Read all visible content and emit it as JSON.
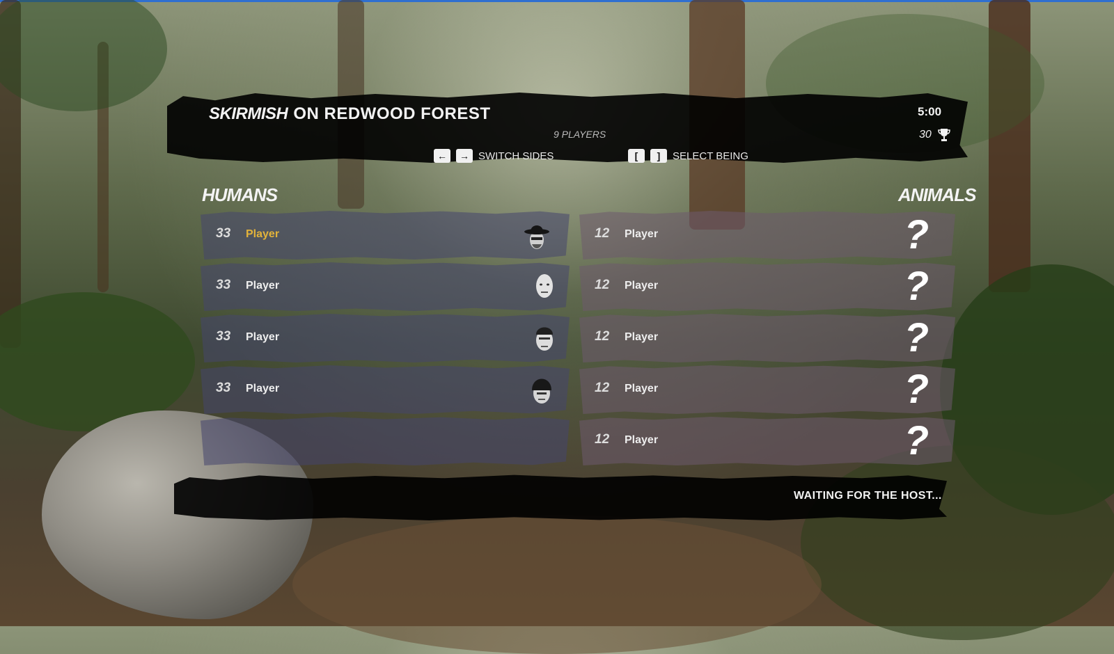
{
  "header": {
    "mode": "SKIRMISH",
    "map_title": "ON REDWOOD FOREST",
    "players_count": "9 PLAYERS",
    "timer": "5:00",
    "score": "30",
    "score_icon": "trophy-icon"
  },
  "hints": {
    "switch_sides": {
      "keys": [
        "←",
        "→"
      ],
      "label": "SWITCH SIDES"
    },
    "select_being": {
      "keys": [
        "[",
        "]"
      ],
      "label": "SELECT BEING"
    }
  },
  "teams": {
    "humans": {
      "label": "HUMANS",
      "slots": [
        {
          "level": "33",
          "name": "Player",
          "is_local": true,
          "avatar": "cowboy-hat-avatar"
        },
        {
          "level": "33",
          "name": "Player",
          "is_local": false,
          "avatar": "bald-avatar"
        },
        {
          "level": "33",
          "name": "Player",
          "is_local": false,
          "avatar": "cap-avatar"
        },
        {
          "level": "33",
          "name": "Player",
          "is_local": false,
          "avatar": "beanie-avatar"
        },
        {
          "level": "",
          "name": "",
          "is_local": false,
          "avatar": ""
        }
      ]
    },
    "animals": {
      "label": "ANIMALS",
      "slots": [
        {
          "level": "12",
          "name": "Player",
          "icon": "?"
        },
        {
          "level": "12",
          "name": "Player",
          "icon": "?"
        },
        {
          "level": "12",
          "name": "Player",
          "icon": "?"
        },
        {
          "level": "12",
          "name": "Player",
          "icon": "?"
        },
        {
          "level": "12",
          "name": "Player",
          "icon": "?"
        }
      ]
    }
  },
  "footer": {
    "status": "WAITING FOR THE HOST..."
  },
  "colors": {
    "local_player": "#e3b33a",
    "human_slot": "#46466e",
    "animal_slot": "#6e5a6e"
  }
}
